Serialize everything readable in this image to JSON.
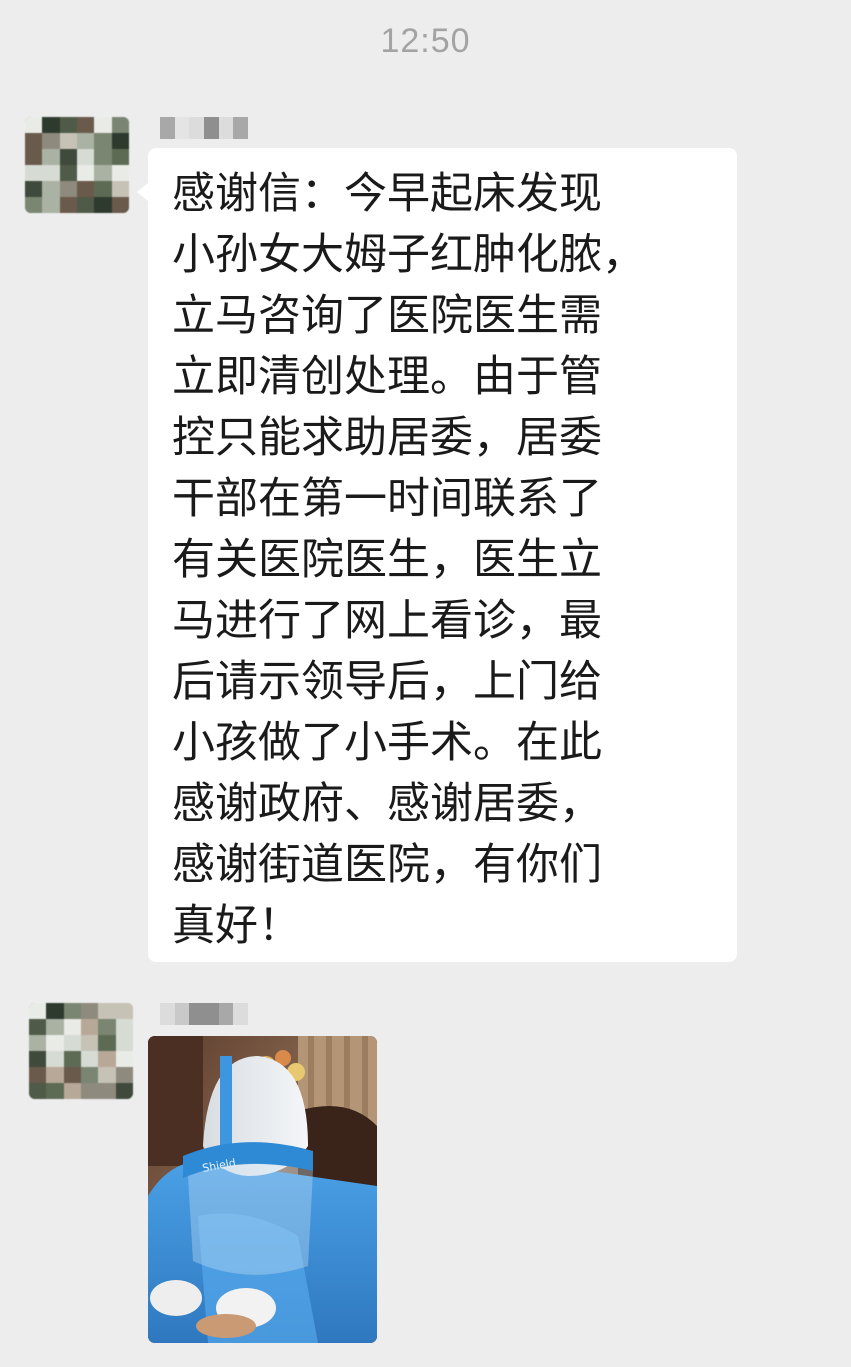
{
  "status": {
    "time": "12:50"
  },
  "messages": [
    {
      "kind": "text",
      "lines": [
        "感谢信：今早起床发现",
        "小孙女大姆子红肿化脓，",
        "立马咨询了医院医生需",
        "立即清创处理。由于管",
        "控只能求助居委，居委",
        "干部在第一时间联系了",
        "有关医院医生，医生立",
        "马进行了网上看诊，最",
        "后请示领导后，上门给",
        "小孩做了小手术。在此",
        "感谢政府、感谢居委，",
        "感谢街道医院，有你们",
        "真好！"
      ]
    },
    {
      "kind": "image",
      "printed_text": "Shield"
    }
  ],
  "colors": {
    "chat_background": "#ededed",
    "bubble_background": "#ffffff",
    "timestamp": "#a3a3a3",
    "message_text": "#1a1a1a",
    "protective_suit": "#3d8fd6"
  }
}
